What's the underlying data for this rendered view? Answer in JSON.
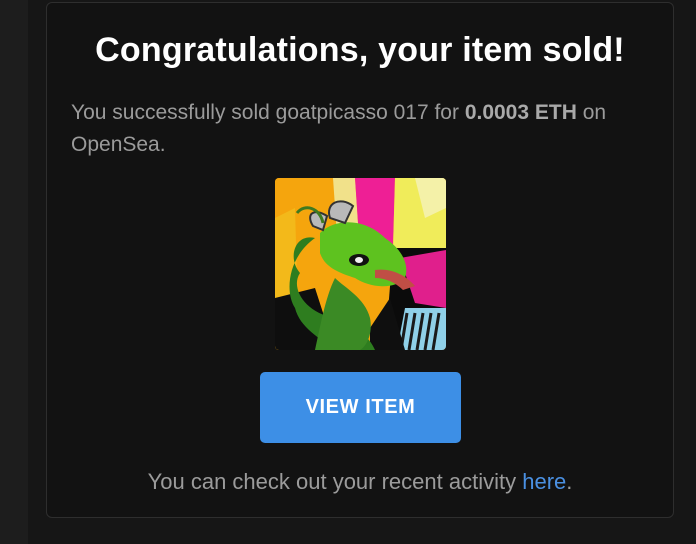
{
  "email": {
    "title": "Congratulations, your item sold!",
    "message_prefix": "You successfully sold ",
    "item_name": "goatpicasso 017",
    "message_middle": " for ",
    "price": "0.0003 ETH",
    "message_suffix": " on OpenSea.",
    "item_image_alt": "goatpicasso 017",
    "view_button_label": "VIEW ITEM",
    "footer_prefix": "You can check out your recent activity ",
    "footer_link": "here",
    "footer_suffix": "."
  },
  "colors": {
    "background": "#161616",
    "card": "#121212",
    "button": "#3d8fe6",
    "link": "#4a90e2",
    "muted_text": "#9b9b9b"
  }
}
